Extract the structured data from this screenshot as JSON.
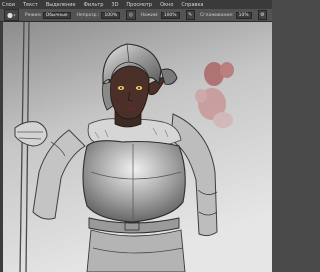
{
  "menu": {
    "items": [
      "Слои",
      "Текст",
      "Выделение",
      "Фильтр",
      "3D",
      "Просмотр",
      "Окно",
      "Справка"
    ]
  },
  "options": {
    "mode_label": "Режим",
    "mode_value": "Обычные",
    "opacity_label": "Непрозр.:",
    "opacity_value": "100%",
    "flow_label": "Нажим:",
    "flow_value": "100%",
    "smoothing_label": "Сглаживание:",
    "smoothing_value": "10%"
  },
  "icons": {
    "brush_preset": "brush-preset-icon",
    "airbrush": "airbrush-icon",
    "settings": "gear-icon",
    "pressure": "pressure-icon"
  },
  "colors": {
    "menubar": "#3a3a3a",
    "optionsbar": "#535353",
    "canvas_light": "#dcdcdc",
    "canvas_dark": "#8f8f8f"
  }
}
